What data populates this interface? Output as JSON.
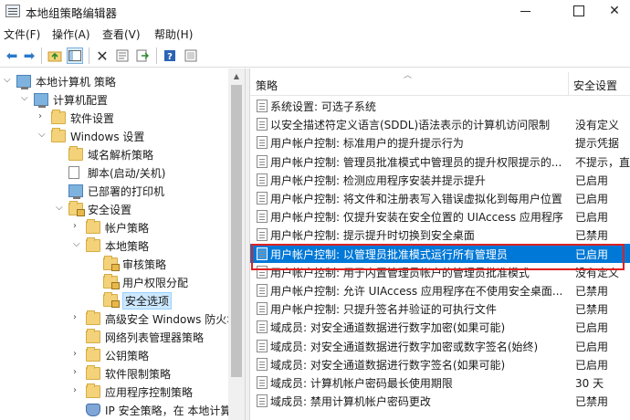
{
  "window": {
    "title": "本地组策略编辑器"
  },
  "menu": {
    "items": [
      "文件(F)",
      "操作(A)",
      "查看(V)",
      "帮助(H)"
    ]
  },
  "tree": {
    "nodes": [
      {
        "label": "本地计算机 策略",
        "icon": "computer-icon",
        "expanded": true
      },
      {
        "label": "计算机配置",
        "icon": "computer-icon",
        "expanded": true
      },
      {
        "label": "软件设置",
        "icon": "folder-icon",
        "expanded": false
      },
      {
        "label": "Windows 设置",
        "icon": "folder-icon",
        "expanded": true
      },
      {
        "label": "域名解析策略",
        "icon": "folder-icon",
        "expanded": false
      },
      {
        "label": "脚本(启动/关机)",
        "icon": "script-icon",
        "expanded": false
      },
      {
        "label": "已部署的打印机",
        "icon": "printer-icon",
        "expanded": false
      },
      {
        "label": "安全设置",
        "icon": "folder-lock-icon",
        "expanded": true
      },
      {
        "label": "帐户策略",
        "icon": "folder-icon",
        "expanded": false
      },
      {
        "label": "本地策略",
        "icon": "folder-icon",
        "expanded": true
      },
      {
        "label": "审核策略",
        "icon": "folder-lock-icon",
        "expanded": false
      },
      {
        "label": "用户权限分配",
        "icon": "folder-lock-icon",
        "expanded": false
      },
      {
        "label": "安全选项",
        "icon": "folder-lock-icon",
        "expanded": false,
        "selected": true
      },
      {
        "label": "高级安全 Windows 防火墙",
        "icon": "folder-icon",
        "expanded": false
      },
      {
        "label": "网络列表管理器策略",
        "icon": "folder-icon",
        "expanded": false
      },
      {
        "label": "公钥策略",
        "icon": "folder-icon",
        "expanded": false
      },
      {
        "label": "软件限制策略",
        "icon": "folder-icon",
        "expanded": false
      },
      {
        "label": "应用程序控制策略",
        "icon": "folder-icon",
        "expanded": false
      },
      {
        "label": "IP 安全策略，在 本地计算机",
        "icon": "ip-security-icon",
        "expanded": false
      }
    ]
  },
  "list": {
    "columns": {
      "policy": "策略",
      "setting": "安全设置"
    },
    "rows": [
      {
        "policy": "系统设置: 可选子系统",
        "setting": ""
      },
      {
        "policy": "以安全描述符定义语言(SDDL)语法表示的计算机访问限制",
        "setting": "没有定义"
      },
      {
        "policy": "用户帐户控制: 标准用户的提升提示行为",
        "setting": "提示凭据"
      },
      {
        "policy": "用户帐户控制: 管理员批准模式中管理员的提升权限提示的...",
        "setting": "不提示，直"
      },
      {
        "policy": "用户帐户控制: 检测应用程序安装并提示提升",
        "setting": "已启用"
      },
      {
        "policy": "用户帐户控制: 将文件和注册表写入错误虚拟化到每用户位置",
        "setting": "已启用"
      },
      {
        "policy": "用户帐户控制: 仅提升安装在安全位置的 UIAccess 应用程序",
        "setting": "已启用"
      },
      {
        "policy": "用户帐户控制: 提示提升时切换到安全桌面",
        "setting": "已禁用"
      },
      {
        "policy": "用户帐户控制: 以管理员批准模式运行所有管理员",
        "setting": "已启用",
        "selected": true
      },
      {
        "policy": "用户帐户控制: 用于内置管理员帐户的管理员批准模式",
        "setting": "没有定义"
      },
      {
        "policy": "用户帐户控制: 允许 UIAccess 应用程序在不使用安全桌面...",
        "setting": "已禁用"
      },
      {
        "policy": "用户帐户控制: 只提升签名并验证的可执行文件",
        "setting": "已禁用"
      },
      {
        "policy": "域成员: 对安全通道数据进行数字加密(如果可能)",
        "setting": "已启用"
      },
      {
        "policy": "域成员: 对安全通道数据进行数字加密或数字签名(始终)",
        "setting": "已启用"
      },
      {
        "policy": "域成员: 对安全通道数据进行数字签名(如果可能)",
        "setting": "已启用"
      },
      {
        "policy": "域成员: 计算机帐户密码最长使用期限",
        "setting": "30 天"
      },
      {
        "policy": "域成员: 禁用计算机帐户密码更改",
        "setting": "已禁用"
      }
    ]
  },
  "colors": {
    "selection": "#0078d7",
    "highlight_box": "#e02020",
    "tree_selection": "#cce8ff"
  }
}
